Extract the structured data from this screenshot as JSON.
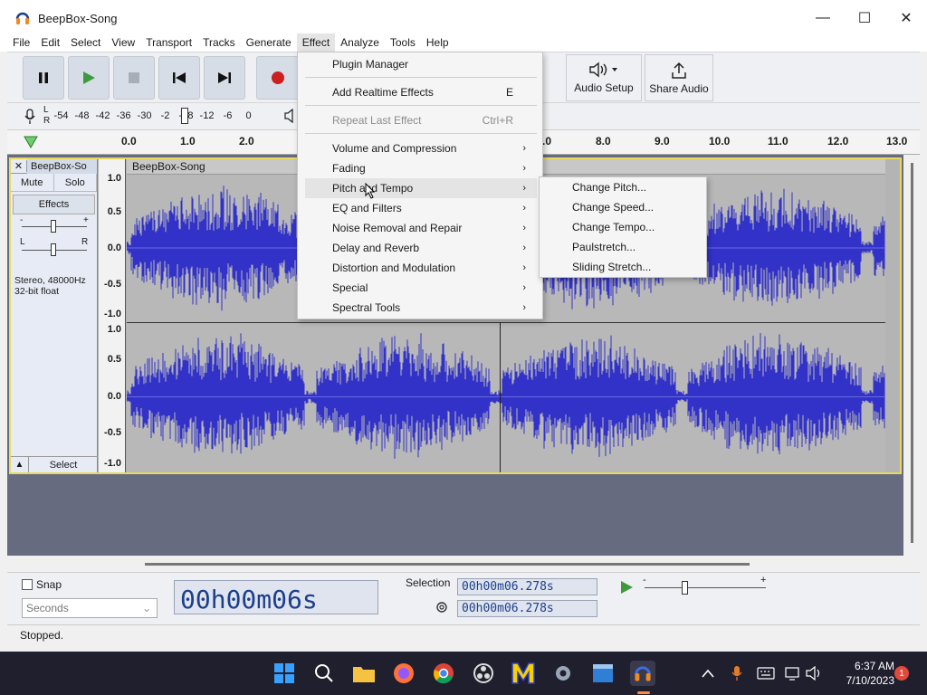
{
  "window": {
    "title": "BeepBox-Song",
    "minimize": "—",
    "maximize": "☐",
    "close": "✕"
  },
  "menu": [
    "File",
    "Edit",
    "Select",
    "View",
    "Transport",
    "Tracks",
    "Generate",
    "Effect",
    "Analyze",
    "Tools",
    "Help"
  ],
  "toolbar": {
    "audio_setup": "Audio Setup",
    "share_audio": "Share Audio"
  },
  "meter": {
    "left": "L",
    "right": "R",
    "scale": [
      "-54",
      "-48",
      "-42",
      "-36",
      "-30",
      "-2",
      "-18",
      "-12",
      "-6",
      "0"
    ]
  },
  "ruler": [
    "0.0",
    "1.0",
    "2.0",
    ".0",
    "8.0",
    "9.0",
    "10.0",
    "11.0",
    "12.0",
    "13.0"
  ],
  "track": {
    "name": "BeepBox-So",
    "close": "✕",
    "mute": "Mute",
    "solo": "Solo",
    "effects": "Effects",
    "gain_minus": "-",
    "gain_plus": "+",
    "pan_left": "L",
    "pan_right": "R",
    "info_line1": "Stereo, 48000Hz",
    "info_line2": "32-bit float",
    "select": "Select",
    "collapse": "▲",
    "clip_name": "BeepBox-Song",
    "vruler": [
      "1.0",
      "0.5",
      "0.0",
      "-0.5",
      "-1.0",
      "1.0",
      "0.5",
      "0.0",
      "-0.5",
      "-1.0"
    ]
  },
  "effect_menu": {
    "items": [
      {
        "label": "Plugin Manager",
        "shortcut": "",
        "submenu": false,
        "disabled": false
      },
      {
        "label": "Add Realtime Effects",
        "shortcut": "E",
        "submenu": false,
        "disabled": false
      },
      {
        "label": "Repeat Last Effect",
        "shortcut": "Ctrl+R",
        "submenu": false,
        "disabled": true
      },
      {
        "label": "Volume and Compression",
        "shortcut": "",
        "submenu": true,
        "disabled": false
      },
      {
        "label": "Fading",
        "shortcut": "",
        "submenu": true,
        "disabled": false
      },
      {
        "label": "Pitch and Tempo",
        "shortcut": "",
        "submenu": true,
        "disabled": false
      },
      {
        "label": "EQ and Filters",
        "shortcut": "",
        "submenu": true,
        "disabled": false
      },
      {
        "label": "Noise Removal and Repair",
        "shortcut": "",
        "submenu": true,
        "disabled": false
      },
      {
        "label": "Delay and Reverb",
        "shortcut": "",
        "submenu": true,
        "disabled": false
      },
      {
        "label": "Distortion and Modulation",
        "shortcut": "",
        "submenu": true,
        "disabled": false
      },
      {
        "label": "Special",
        "shortcut": "",
        "submenu": true,
        "disabled": false
      },
      {
        "label": "Spectral Tools",
        "shortcut": "",
        "submenu": true,
        "disabled": false
      }
    ],
    "arrow": "›"
  },
  "pitch_submenu": [
    "Change Pitch...",
    "Change Speed...",
    "Change Tempo...",
    "Paulstretch...",
    "Sliding Stretch..."
  ],
  "bottom": {
    "snap": "Snap",
    "seconds": "Seconds",
    "big_time": "00h00m06s",
    "selection": "Selection",
    "sel_start": "00h00m06.278s",
    "sel_end": "00h00m06.278s",
    "slider_minus": "-",
    "slider_plus": "+"
  },
  "status": "Stopped.",
  "clock": {
    "time": "6:37 AM",
    "date": "7/10/2023"
  },
  "notification_count": "1",
  "colors": {
    "waveform": "#3232c8",
    "track_border": "#e8d95e",
    "record": "#cc1f1f",
    "timer": "#1c3f8c"
  }
}
